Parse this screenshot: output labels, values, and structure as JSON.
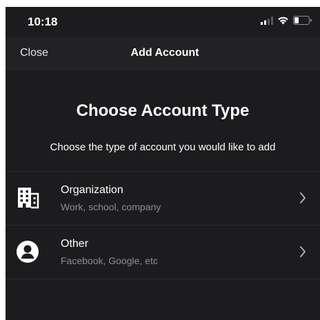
{
  "status_bar": {
    "time": "10:18",
    "icons": [
      "cellular-signal-icon",
      "wifi-icon",
      "battery-icon"
    ]
  },
  "nav": {
    "close_label": "Close",
    "title": "Add Account"
  },
  "main": {
    "heading": "Choose Account Type",
    "subheading": "Choose the type of account you would like to add",
    "account_types": [
      {
        "title": "Organization",
        "subtitle": "Work, school, company",
        "icon": "building-icon"
      },
      {
        "title": "Other",
        "subtitle": "Facebook, Google, etc",
        "icon": "person-icon"
      }
    ]
  },
  "colors": {
    "background": "#1c1c1e",
    "nav_background": "#222224",
    "text_primary": "#ffffff",
    "text_secondary": "#8e8e93",
    "separator": "#2e2e30"
  }
}
